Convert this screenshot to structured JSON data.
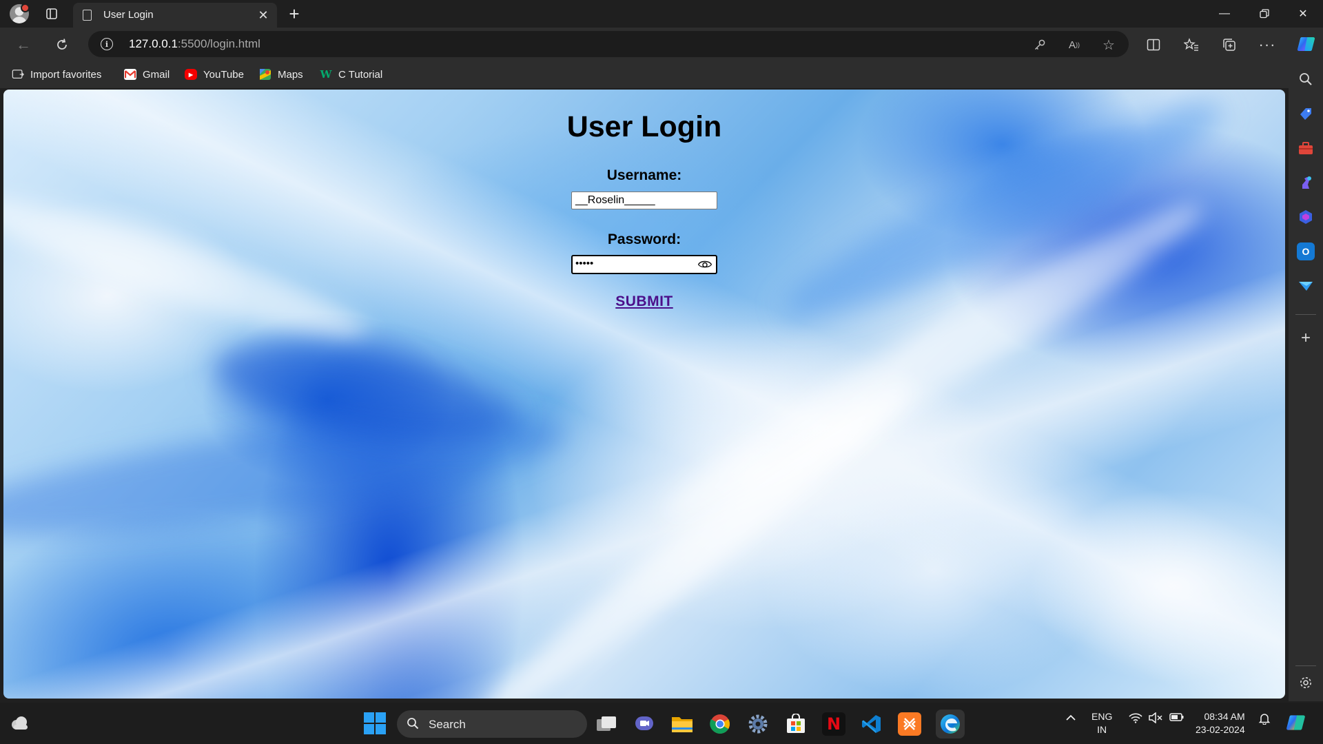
{
  "browser": {
    "tab_title": "User Login",
    "url_host": "127.0.0.1",
    "url_rest": ":5500/login.html"
  },
  "favorites": [
    {
      "label": "Import favorites",
      "icon": "import-icon"
    },
    {
      "label": "Gmail",
      "icon": "gmail-icon"
    },
    {
      "label": "YouTube",
      "icon": "youtube-icon"
    },
    {
      "label": "Maps",
      "icon": "maps-icon"
    },
    {
      "label": "C Tutorial",
      "icon": "w3schools-icon"
    }
  ],
  "page": {
    "title": "User Login",
    "username_label": "Username:",
    "username_value": "__Roselin_____",
    "password_label": "Password:",
    "password_mask": "•••••",
    "submit_label": "SUBMIT"
  },
  "taskbar": {
    "search_label": "Search",
    "lang_top": "ENG",
    "lang_bottom": "IN",
    "time": "08:34 AM",
    "date": "23-02-2024"
  },
  "colors": {
    "submit_link": "#4b0f8a",
    "chrome_dark": "#1f1f1f",
    "toolbar": "#2d2d2d",
    "start_blue": "#2aa1f5"
  }
}
